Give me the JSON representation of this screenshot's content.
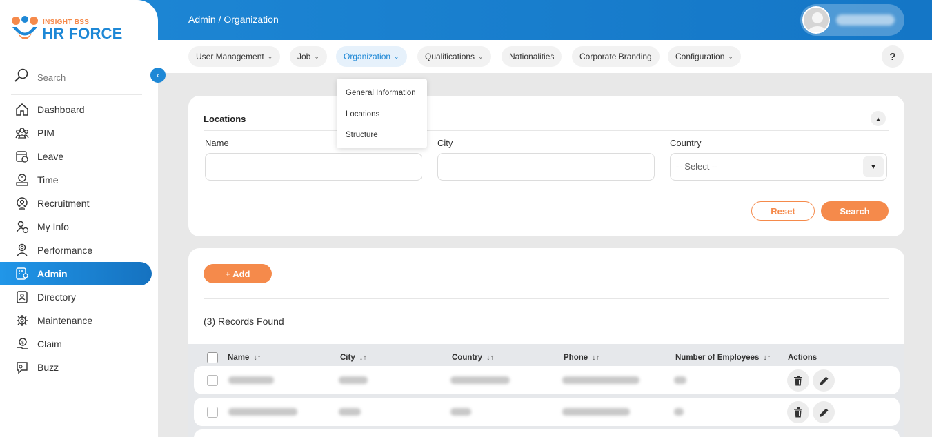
{
  "header": {
    "breadcrumb": "Admin / Organization",
    "user_avatar_alt": "user-avatar"
  },
  "brand": {
    "small": "INSIGHT BSS",
    "big": "HR FORCE",
    "primary_color": "#1e88d6",
    "accent_color": "#f58a4b"
  },
  "sidebar": {
    "search_placeholder": "Search",
    "items": [
      {
        "label": "Dashboard",
        "icon": "home-icon"
      },
      {
        "label": "PIM",
        "icon": "users-icon"
      },
      {
        "label": "Leave",
        "icon": "leave-icon"
      },
      {
        "label": "Time",
        "icon": "time-icon"
      },
      {
        "label": "Recruitment",
        "icon": "recruitment-icon"
      },
      {
        "label": "My Info",
        "icon": "my-info-icon"
      },
      {
        "label": "Performance",
        "icon": "performance-icon"
      },
      {
        "label": "Admin",
        "icon": "admin-icon",
        "active": true
      },
      {
        "label": "Directory",
        "icon": "directory-icon"
      },
      {
        "label": "Maintenance",
        "icon": "maintenance-icon"
      },
      {
        "label": "Claim",
        "icon": "claim-icon"
      },
      {
        "label": "Buzz",
        "icon": "buzz-icon"
      }
    ]
  },
  "topnav": {
    "items": [
      {
        "label": "User Management",
        "dropdown": true
      },
      {
        "label": "Job",
        "dropdown": true
      },
      {
        "label": "Organization",
        "dropdown": true,
        "active": true
      },
      {
        "label": "Qualifications",
        "dropdown": true
      },
      {
        "label": "Nationalities",
        "dropdown": false
      },
      {
        "label": "Corporate Branding",
        "dropdown": false
      },
      {
        "label": "Configuration",
        "dropdown": true
      }
    ],
    "help_label": "?",
    "org_menu": [
      "General Information",
      "Locations",
      "Structure"
    ]
  },
  "filter": {
    "title": "Locations",
    "name_label": "Name",
    "city_label": "City",
    "country_label": "Country",
    "country_selected": "-- Select --",
    "reset_label": "Reset",
    "search_label": "Search"
  },
  "list": {
    "add_label": "+ Add",
    "records_text": "(3) Records Found",
    "columns": [
      "Name",
      "City",
      "Country",
      "Phone",
      "Number of Employees",
      "Actions"
    ]
  }
}
